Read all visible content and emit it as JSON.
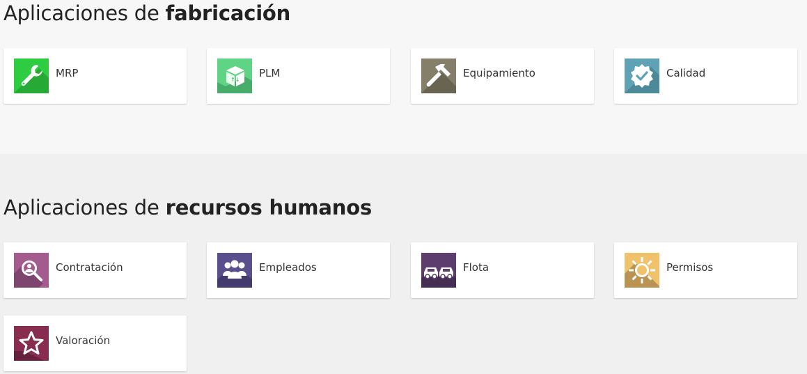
{
  "manufacturing": {
    "heading_prefix": "Aplicaciones de",
    "heading_bold": "fabricación",
    "apps": [
      {
        "label": "MRP",
        "icon": "wrench-icon",
        "color": "#2ecc40"
      },
      {
        "label": "PLM",
        "icon": "box-icon",
        "color": "#5fd485"
      },
      {
        "label": "Equipamiento",
        "icon": "hammer-icon",
        "color": "#857f6a"
      },
      {
        "label": "Calidad",
        "icon": "quality-badge-icon",
        "color": "#5fa2b5"
      }
    ]
  },
  "human_resources": {
    "heading_prefix": "Aplicaciones de",
    "heading_bold": "recursos humanos",
    "apps": [
      {
        "label": "Contratación",
        "icon": "magnifier-person-icon",
        "color": "#a45c8f"
      },
      {
        "label": "Empleados",
        "icon": "people-icon",
        "color": "#5a4e8c"
      },
      {
        "label": "Flota",
        "icon": "cars-icon",
        "color": "#5c3d6e"
      },
      {
        "label": "Permisos",
        "icon": "sun-icon",
        "color": "#f0c26b"
      },
      {
        "label": "Valoración",
        "icon": "star-icon",
        "color": "#872d4f"
      }
    ]
  }
}
